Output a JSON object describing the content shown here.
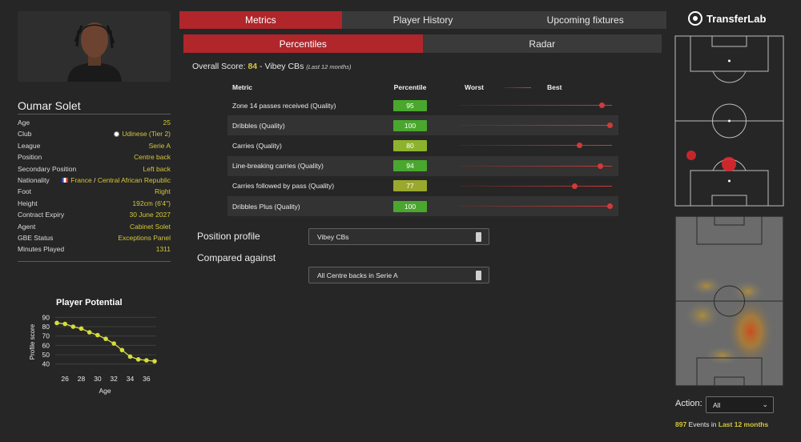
{
  "player": {
    "name": "Oumar Solet",
    "info": [
      {
        "key": "Age",
        "value": "25"
      },
      {
        "key": "Club",
        "value": "Udinese (Tier 2)"
      },
      {
        "key": "League",
        "value": "Serie A"
      },
      {
        "key": "Position",
        "value": "Centre back"
      },
      {
        "key": "Secondary Position",
        "value": "Left back"
      },
      {
        "key": "Nationality",
        "value_a": "France",
        "sep": " / ",
        "value_b": "Central African Republic"
      },
      {
        "key": "Foot",
        "value": "Right"
      },
      {
        "key": "Height",
        "value": "192cm (6'4\")"
      },
      {
        "key": "Contract Expiry",
        "value": "30 June 2027"
      },
      {
        "key": "Agent",
        "value": "Cabinet Solet"
      },
      {
        "key": "GBE Status",
        "value": "Exceptions Panel"
      },
      {
        "key": "Minutes Played",
        "value": "1311"
      }
    ]
  },
  "potential_chart": {
    "chart_data": {
      "type": "line",
      "title": "Player Potential",
      "xlabel": "Age",
      "ylabel": "Profile score",
      "x": [
        25,
        26,
        27,
        28,
        29,
        30,
        31,
        32,
        33,
        34,
        35,
        36,
        37
      ],
      "values": [
        84,
        83,
        80,
        78,
        74,
        71,
        67,
        62,
        55,
        48,
        45,
        44,
        43
      ],
      "x_ticks": [
        "26",
        "28",
        "30",
        "32",
        "34",
        "36"
      ],
      "y_ticks": [
        "90",
        "80",
        "70",
        "60",
        "50",
        "40"
      ],
      "xlim": [
        25,
        37
      ],
      "ylim": [
        38,
        92
      ],
      "color": "#d6dd3a",
      "grid": true
    }
  },
  "tabs": [
    {
      "label": "Metrics",
      "active": true
    },
    {
      "label": "Player History",
      "active": false
    },
    {
      "label": "Upcoming fixtures",
      "active": false
    }
  ],
  "subtabs": [
    {
      "label": "Percentiles",
      "active": true
    },
    {
      "label": "Radar",
      "active": false
    }
  ],
  "overall": {
    "label": "Overall Score:",
    "score": "84",
    "sep": " - ",
    "profile": "Vibey CBs",
    "period": "(Last 12 months)"
  },
  "metrics_table": {
    "headers": {
      "metric": "Metric",
      "percentile": "Percentile",
      "worst": "Worst",
      "best": "Best"
    },
    "rows": [
      {
        "metric": "Zone 14 passes received (Quality)",
        "percentile": 95,
        "value_label": "95",
        "color": "#4aa72e"
      },
      {
        "metric": "Dribbles (Quality)",
        "percentile": 100,
        "value_label": "100",
        "color": "#4aa72e"
      },
      {
        "metric": "Carries (Quality)",
        "percentile": 80,
        "value_label": "80",
        "color": "#8db32e"
      },
      {
        "metric": "Line-breaking carries (Quality)",
        "percentile": 94,
        "value_label": "94",
        "color": "#4aa72e"
      },
      {
        "metric": "Carries followed by pass (Quality)",
        "percentile": 77,
        "value_label": "77",
        "color": "#9aa82e"
      },
      {
        "metric": "Dribbles Plus (Quality)",
        "percentile": 100,
        "value_label": "100",
        "color": "#4aa72e"
      }
    ]
  },
  "selectors": {
    "position_profile": {
      "label": "Position profile",
      "value": "Vibey CBs"
    },
    "compared_against": {
      "label": "Compared against",
      "value": "All Centre backs in Serie A"
    }
  },
  "brand": {
    "name": "TransferLab"
  },
  "action": {
    "label": "Action:",
    "value": "All"
  },
  "events": {
    "count": "897",
    "middle": " Events in ",
    "period": "Last 12 months"
  }
}
